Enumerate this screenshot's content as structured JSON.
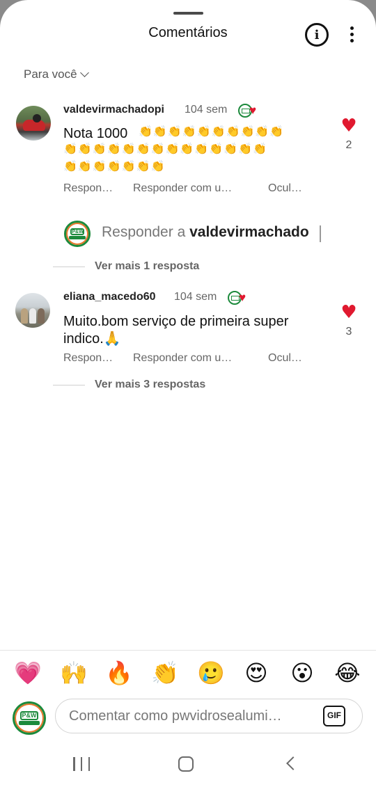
{
  "header": {
    "title": "Comentários",
    "info_icon": "info-icon",
    "more_icon": "more-options-icon"
  },
  "filter": {
    "label": "Para você"
  },
  "comments": [
    {
      "username": "valdevirmachadopi",
      "time": "104 sem",
      "text": "Nota 1000",
      "claps_line1": "👏👏👏👏👏👏👏👏👏👏",
      "claps_line2": "👏👏👏👏👏👏👏👏👏👏👏👏👏👏",
      "claps_line3": "👏👏👏👏👏👏👏",
      "likes": "2",
      "actions": [
        "Respon…",
        "Responder com u…",
        "Ocul…"
      ],
      "reply_prompt": "Responder a",
      "reply_target": "valdevirmachado",
      "more_replies": "Ver mais 1 resposta"
    },
    {
      "username": "eliana_macedo60",
      "time": "104 sem",
      "text_line1": "Muito.bom serviço de primeira super",
      "text_line2": "indico.🙏",
      "likes": "3",
      "actions": [
        "Respon…",
        "Responder com u…",
        "Ocul…"
      ],
      "more_replies": "Ver mais 3 respostas"
    }
  ],
  "reactions": [
    "💗",
    "🙌",
    "🔥",
    "👏",
    "🥲",
    "😍",
    "😮",
    "😂"
  ],
  "composer": {
    "placeholder": "Comentar como pwvidrosealumi…",
    "gif_label": "GIF"
  },
  "brand": {
    "logo_text": "P&W",
    "accent_green": "#1c8a3c",
    "accent_orange": "#e8762a",
    "like_red": "#e0192f"
  }
}
